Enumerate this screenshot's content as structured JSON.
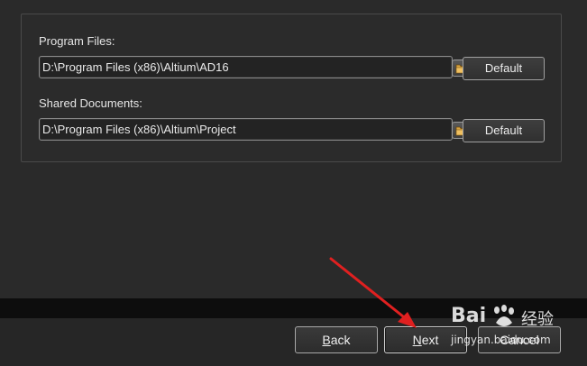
{
  "program_files": {
    "label": "Program Files:",
    "path": "D:\\Program Files (x86)\\Altium\\AD16",
    "browse_icon": "folder-icon",
    "default_label": "Default"
  },
  "shared_documents": {
    "label": "Shared Documents:",
    "path": "D:\\Program Files (x86)\\Altium\\Project",
    "browse_icon": "folder-icon",
    "default_label": "Default"
  },
  "footer": {
    "back_label": "Back",
    "back_mnemonic": "B",
    "back_rest": "ack",
    "next_label": "Next",
    "next_mnemonic": "N",
    "next_rest": "ext",
    "cancel_label": "Cancel"
  },
  "watermark": {
    "brand": "Bai",
    "brand_cn": "经验",
    "url": "jingyan.baidu.com"
  },
  "colors": {
    "background": "#2a2a2a",
    "annotation_arrow": "#e02020"
  }
}
